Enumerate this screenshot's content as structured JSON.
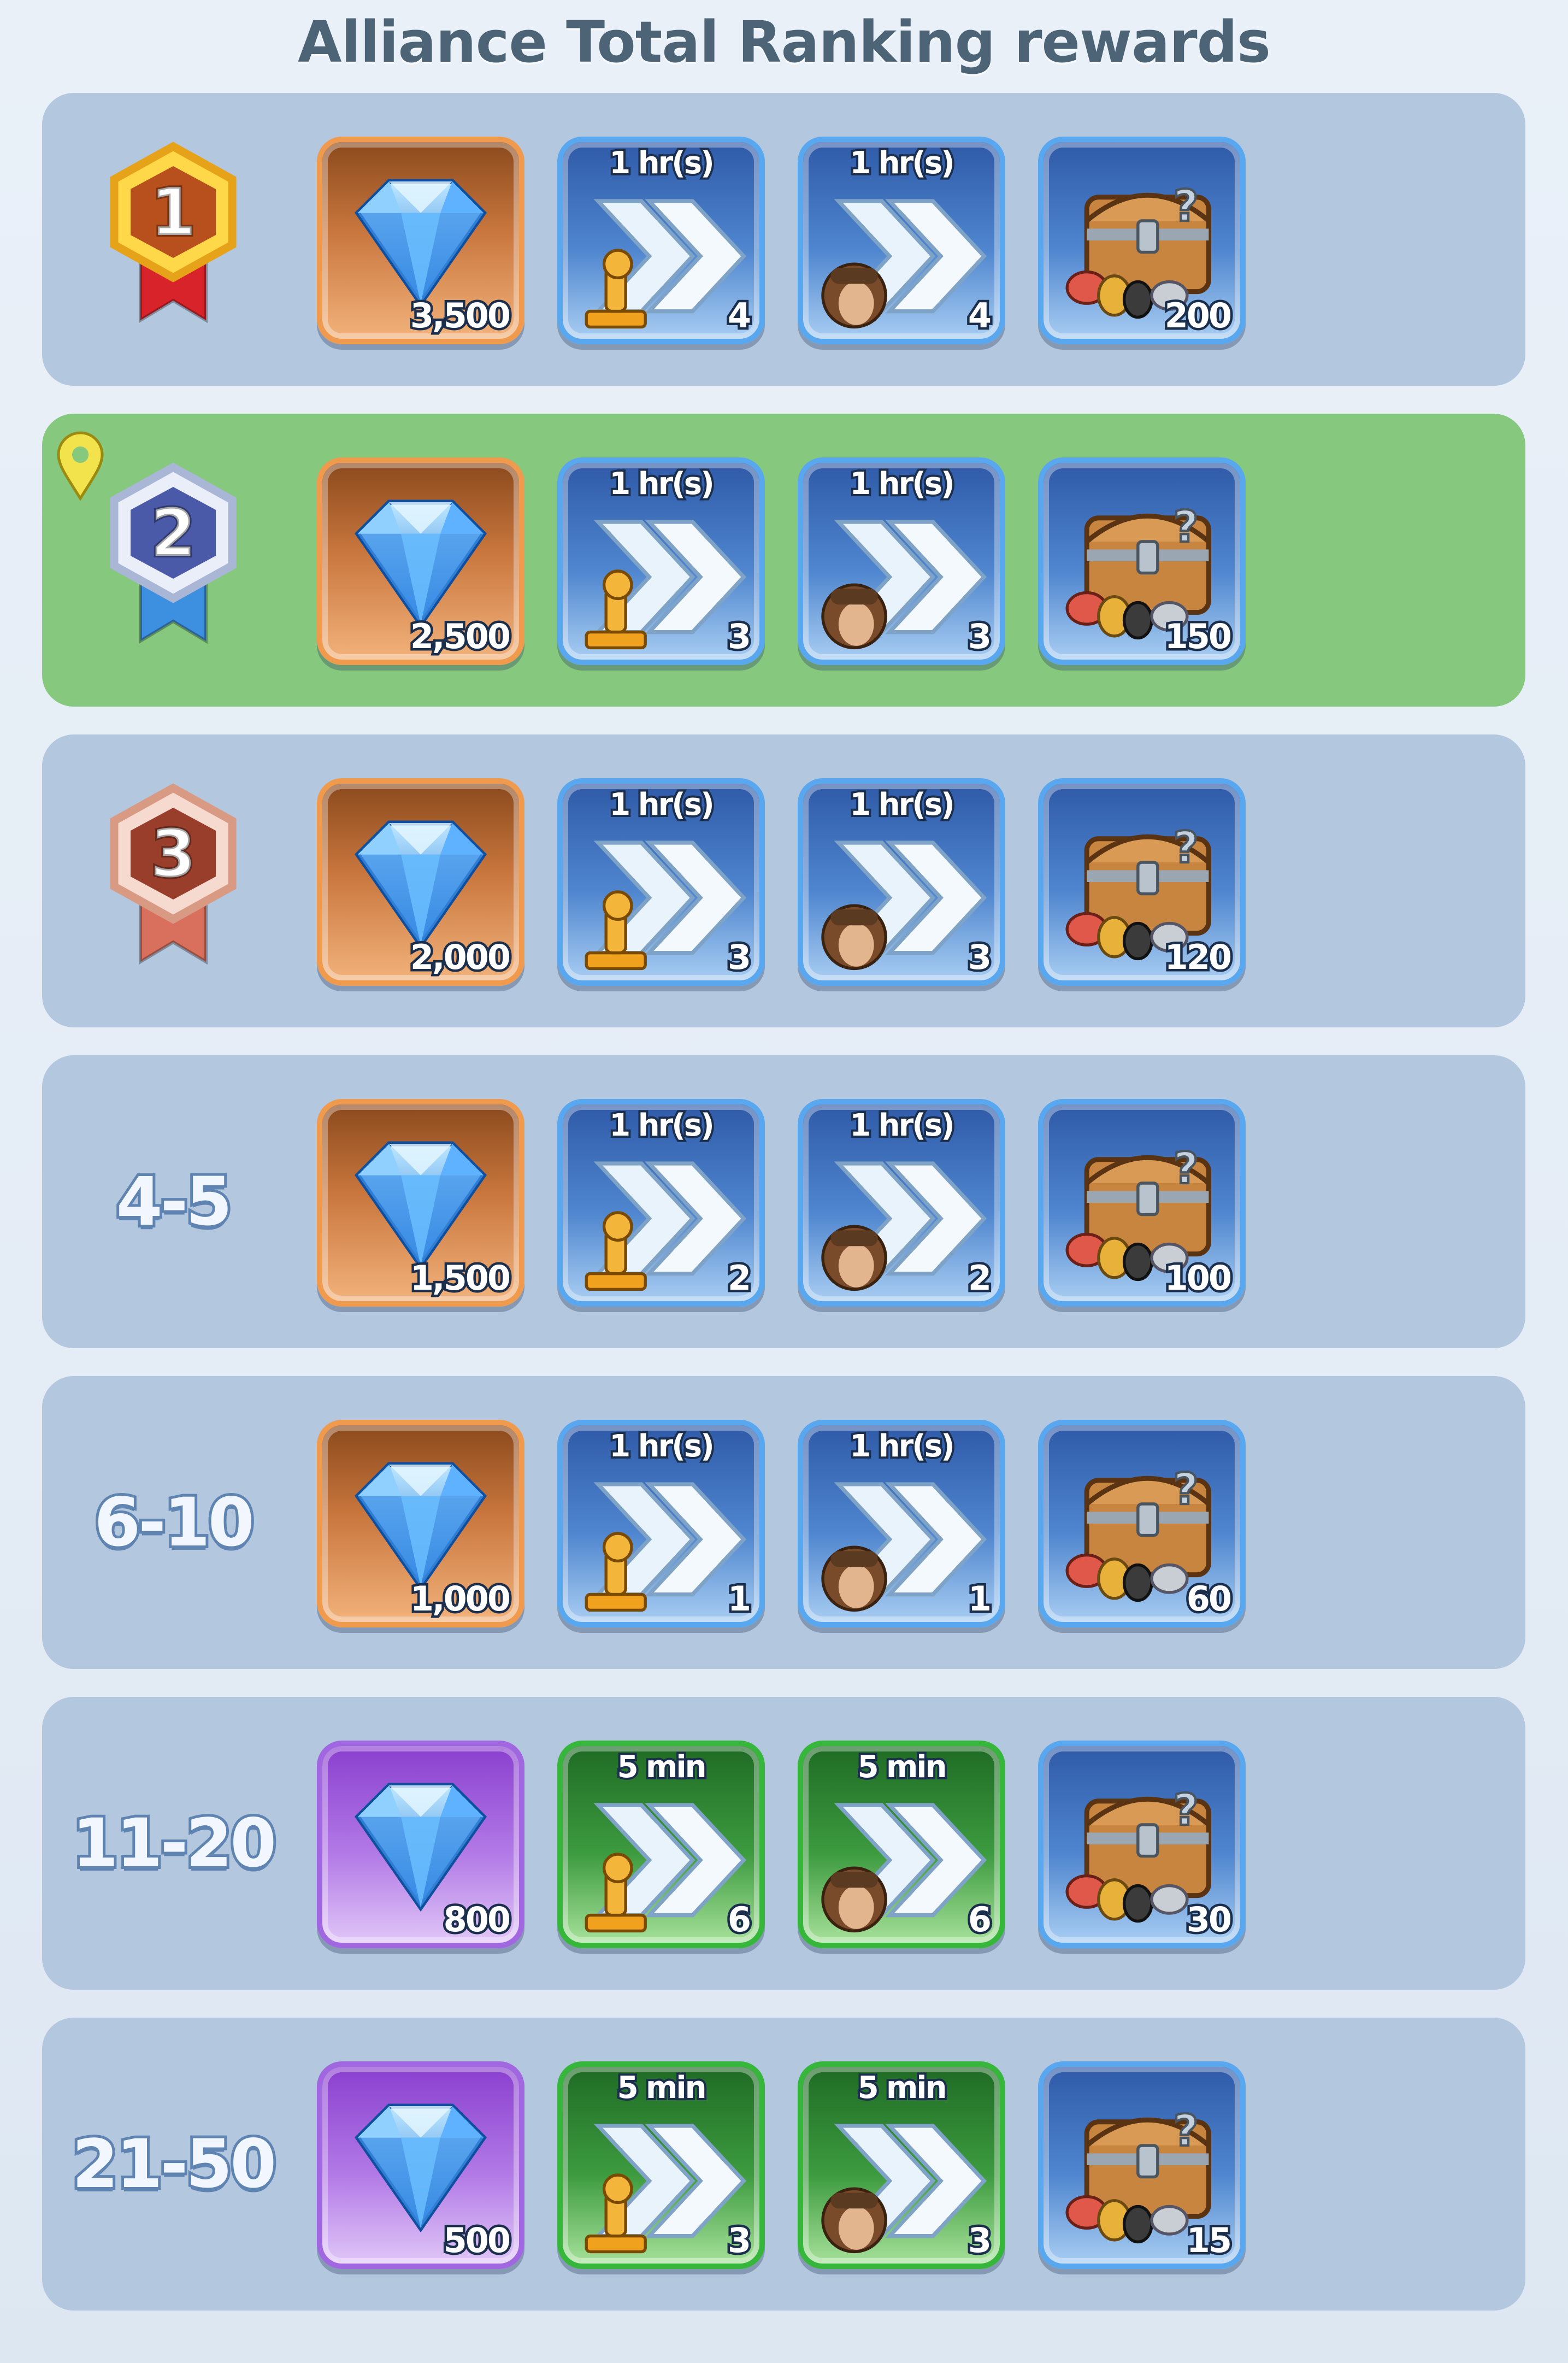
{
  "header": {
    "title": "Alliance Total Ranking rewards"
  },
  "colors": {
    "row_bg": "#b3c7df",
    "row_current_bg": "#86c97e",
    "gold": "#f2b423",
    "silver": "#6f7fc2",
    "bronze": "#c9745f"
  },
  "icons": {
    "gem": "blue-gem-icon",
    "research_speedup": "research-speedup-icon",
    "training_speedup": "training-speedup-icon",
    "chest": "resource-chest-icon",
    "current_marker": "location-pin-icon"
  },
  "rows": [
    {
      "rank": "1",
      "medal": "gold",
      "current": false,
      "gems": "3,500",
      "gem_frame": "orange",
      "speed_duration": "1 hr(s)",
      "speed_frame": "blue",
      "research_qty": "4",
      "training_qty": "4",
      "chest_qty": "200"
    },
    {
      "rank": "2",
      "medal": "silver",
      "current": true,
      "gems": "2,500",
      "gem_frame": "orange",
      "speed_duration": "1 hr(s)",
      "speed_frame": "blue",
      "research_qty": "3",
      "training_qty": "3",
      "chest_qty": "150"
    },
    {
      "rank": "3",
      "medal": "bronze",
      "current": false,
      "gems": "2,000",
      "gem_frame": "orange",
      "speed_duration": "1 hr(s)",
      "speed_frame": "blue",
      "research_qty": "3",
      "training_qty": "3",
      "chest_qty": "120"
    },
    {
      "rank": "4-5",
      "current": false,
      "gems": "1,500",
      "gem_frame": "orange",
      "speed_duration": "1 hr(s)",
      "speed_frame": "blue",
      "research_qty": "2",
      "training_qty": "2",
      "chest_qty": "100"
    },
    {
      "rank": "6-10",
      "current": false,
      "gems": "1,000",
      "gem_frame": "orange",
      "speed_duration": "1 hr(s)",
      "speed_frame": "blue",
      "research_qty": "1",
      "training_qty": "1",
      "chest_qty": "60"
    },
    {
      "rank": "11-20",
      "current": false,
      "gems": "800",
      "gem_frame": "purple",
      "speed_duration": "5 min",
      "speed_frame": "green",
      "research_qty": "6",
      "training_qty": "6",
      "chest_qty": "30"
    },
    {
      "rank": "21-50",
      "current": false,
      "gems": "500",
      "gem_frame": "purple",
      "speed_duration": "5 min",
      "speed_frame": "green",
      "research_qty": "3",
      "training_qty": "3",
      "chest_qty": "15"
    }
  ]
}
